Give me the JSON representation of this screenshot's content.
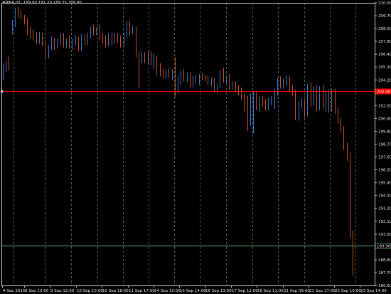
{
  "header": {
    "symbol_tf": "#JPKA,H1",
    "ohlc": "189.90 191.20 189.35 189.90"
  },
  "colors": {
    "background": "#000000",
    "up": "#3a78c8",
    "down": "#c8502a",
    "grid": "#4a6a4a",
    "axis": "#cccccc",
    "bid_line": "#ff0000",
    "price_line": "#5fa87a",
    "text": "#e8e8e8"
  },
  "chart_data": {
    "type": "candlestick",
    "symbol": "#JPKA",
    "timeframe": "H1",
    "ylim": [
      186.6,
      210.0
    ],
    "y_ticks": [
      "210.00",
      "209.70",
      "208.00",
      "207.80",
      "206.40",
      "205.30",
      "204.20",
      "203.10",
      "202.00",
      "200.90",
      "199.80",
      "198.70",
      "197.60",
      "196.50",
      "195.40",
      "194.30",
      "193.20",
      "192.10",
      "191.00",
      "189.90",
      "188.80",
      "187.70",
      "186.60"
    ],
    "x_ticks": [
      "4 Sep 2015",
      "8 Sep 13:00",
      "9 Sep 12:00",
      "10 Sep 10:00",
      "10 Sep 18:00",
      "11 Sep 17:00",
      "14 Sep 15:00",
      "15 Sep 14:00",
      "16 Sep 13:00",
      "17 Sep 12:00",
      "18 Sep 11:00",
      "21 Sep 09:00",
      "21 Sep 17:00",
      "22 Sep 16:00",
      "23 Sep 14:00"
    ],
    "bid_label": "202.68",
    "bid_price": 202.68,
    "last_price_label": "189.90",
    "last_price": 189.9,
    "candles": [
      {
        "o": 204.3,
        "h": 205.0,
        "l": 203.6,
        "c": 204.6
      },
      {
        "o": 204.6,
        "h": 205.2,
        "l": 204.3,
        "c": 205.0
      },
      {
        "o": 205.0,
        "h": 205.6,
        "l": 204.4,
        "c": 204.7
      },
      {
        "o": 207.8,
        "h": 208.6,
        "l": 207.4,
        "c": 208.3
      },
      {
        "o": 208.3,
        "h": 209.6,
        "l": 208.0,
        "c": 209.3
      },
      {
        "o": 209.3,
        "h": 209.7,
        "l": 208.8,
        "c": 209.1
      },
      {
        "o": 209.1,
        "h": 209.4,
        "l": 208.6,
        "c": 208.8
      },
      {
        "o": 208.8,
        "h": 209.0,
        "l": 208.2,
        "c": 208.4
      },
      {
        "o": 208.4,
        "h": 208.7,
        "l": 207.3,
        "c": 207.6
      },
      {
        "o": 207.6,
        "h": 208.0,
        "l": 207.0,
        "c": 207.4
      },
      {
        "o": 207.4,
        "h": 207.8,
        "l": 206.9,
        "c": 207.2
      },
      {
        "o": 207.2,
        "h": 207.6,
        "l": 206.6,
        "c": 206.9
      },
      {
        "o": 206.9,
        "h": 207.6,
        "l": 206.6,
        "c": 207.3
      },
      {
        "o": 207.3,
        "h": 207.5,
        "l": 206.4,
        "c": 206.6
      },
      {
        "o": 206.6,
        "h": 206.9,
        "l": 205.4,
        "c": 205.7
      },
      {
        "o": 205.7,
        "h": 206.5,
        "l": 205.4,
        "c": 206.3
      },
      {
        "o": 206.3,
        "h": 207.2,
        "l": 206.1,
        "c": 206.9
      },
      {
        "o": 206.9,
        "h": 207.1,
        "l": 206.1,
        "c": 206.4
      },
      {
        "o": 206.4,
        "h": 207.0,
        "l": 206.2,
        "c": 206.8
      },
      {
        "o": 206.8,
        "h": 207.5,
        "l": 206.5,
        "c": 207.3
      },
      {
        "o": 207.3,
        "h": 207.5,
        "l": 206.3,
        "c": 206.5
      },
      {
        "o": 206.5,
        "h": 207.0,
        "l": 206.3,
        "c": 206.8
      },
      {
        "o": 206.8,
        "h": 207.3,
        "l": 206.2,
        "c": 206.4
      },
      {
        "o": 206.4,
        "h": 207.0,
        "l": 206.1,
        "c": 206.8
      },
      {
        "o": 206.8,
        "h": 207.3,
        "l": 206.5,
        "c": 207.1
      },
      {
        "o": 207.1,
        "h": 207.2,
        "l": 206.0,
        "c": 206.2
      },
      {
        "o": 206.2,
        "h": 207.4,
        "l": 206.0,
        "c": 207.2
      },
      {
        "o": 207.2,
        "h": 207.4,
        "l": 206.5,
        "c": 206.8
      },
      {
        "o": 206.8,
        "h": 207.5,
        "l": 206.5,
        "c": 207.4
      },
      {
        "o": 207.4,
        "h": 208.0,
        "l": 207.1,
        "c": 207.8
      },
      {
        "o": 207.8,
        "h": 208.2,
        "l": 207.3,
        "c": 207.5
      },
      {
        "o": 207.5,
        "h": 208.0,
        "l": 207.3,
        "c": 207.8
      },
      {
        "o": 207.8,
        "h": 208.2,
        "l": 206.9,
        "c": 207.2
      },
      {
        "o": 207.2,
        "h": 207.5,
        "l": 206.6,
        "c": 207.0
      },
      {
        "o": 207.0,
        "h": 207.3,
        "l": 206.3,
        "c": 206.6
      },
      {
        "o": 206.6,
        "h": 207.5,
        "l": 206.4,
        "c": 207.3
      },
      {
        "o": 207.3,
        "h": 207.5,
        "l": 206.5,
        "c": 206.8
      },
      {
        "o": 206.8,
        "h": 207.5,
        "l": 206.6,
        "c": 207.3
      },
      {
        "o": 207.3,
        "h": 207.5,
        "l": 206.7,
        "c": 206.9
      },
      {
        "o": 206.9,
        "h": 207.3,
        "l": 206.3,
        "c": 206.6
      },
      {
        "o": 206.6,
        "h": 207.5,
        "l": 206.4,
        "c": 207.3
      },
      {
        "o": 207.3,
        "h": 208.5,
        "l": 207.1,
        "c": 208.3
      },
      {
        "o": 208.3,
        "h": 208.5,
        "l": 207.3,
        "c": 207.6
      },
      {
        "o": 207.6,
        "h": 208.1,
        "l": 207.4,
        "c": 207.9
      },
      {
        "o": 207.9,
        "h": 208.0,
        "l": 205.5,
        "c": 205.8
      },
      {
        "o": 205.8,
        "h": 206.0,
        "l": 202.9,
        "c": 205.2
      },
      {
        "o": 205.2,
        "h": 206.0,
        "l": 205.0,
        "c": 205.7
      },
      {
        "o": 205.7,
        "h": 205.9,
        "l": 205.0,
        "c": 205.2
      },
      {
        "o": 205.2,
        "h": 206.0,
        "l": 204.9,
        "c": 205.6
      },
      {
        "o": 205.6,
        "h": 206.0,
        "l": 204.8,
        "c": 205.0
      },
      {
        "o": 205.0,
        "h": 205.8,
        "l": 204.5,
        "c": 205.4
      },
      {
        "o": 205.4,
        "h": 205.6,
        "l": 204.0,
        "c": 204.5
      },
      {
        "o": 204.5,
        "h": 205.0,
        "l": 203.9,
        "c": 204.3
      },
      {
        "o": 204.3,
        "h": 204.6,
        "l": 203.7,
        "c": 203.9
      },
      {
        "o": 203.9,
        "h": 204.5,
        "l": 203.7,
        "c": 204.3
      },
      {
        "o": 204.3,
        "h": 204.6,
        "l": 203.8,
        "c": 204.0
      },
      {
        "o": 204.0,
        "h": 204.5,
        "l": 203.6,
        "c": 204.3
      },
      {
        "o": 204.3,
        "h": 205.5,
        "l": 202.2,
        "c": 203.0
      },
      {
        "o": 203.0,
        "h": 204.0,
        "l": 202.5,
        "c": 203.5
      },
      {
        "o": 203.5,
        "h": 204.4,
        "l": 203.2,
        "c": 204.2
      },
      {
        "o": 204.2,
        "h": 204.5,
        "l": 203.5,
        "c": 203.7
      },
      {
        "o": 203.7,
        "h": 204.2,
        "l": 203.4,
        "c": 204.0
      },
      {
        "o": 204.0,
        "h": 204.3,
        "l": 203.0,
        "c": 203.2
      },
      {
        "o": 203.2,
        "h": 204.0,
        "l": 203.0,
        "c": 203.8
      },
      {
        "o": 203.8,
        "h": 204.0,
        "l": 203.3,
        "c": 203.5
      },
      {
        "o": 203.5,
        "h": 204.1,
        "l": 203.2,
        "c": 203.9
      },
      {
        "o": 203.9,
        "h": 204.2,
        "l": 203.6,
        "c": 203.8
      },
      {
        "o": 203.8,
        "h": 204.0,
        "l": 203.5,
        "c": 203.7
      },
      {
        "o": 203.7,
        "h": 204.0,
        "l": 203.2,
        "c": 203.5
      },
      {
        "o": 203.5,
        "h": 203.8,
        "l": 203.1,
        "c": 203.6
      },
      {
        "o": 203.6,
        "h": 203.8,
        "l": 202.6,
        "c": 202.9
      },
      {
        "o": 202.9,
        "h": 203.3,
        "l": 202.5,
        "c": 203.1
      },
      {
        "o": 203.1,
        "h": 204.4,
        "l": 202.9,
        "c": 204.1
      },
      {
        "o": 204.1,
        "h": 204.6,
        "l": 203.4,
        "c": 203.6
      },
      {
        "o": 203.6,
        "h": 204.0,
        "l": 203.3,
        "c": 203.9
      },
      {
        "o": 203.9,
        "h": 204.1,
        "l": 202.8,
        "c": 203.1
      },
      {
        "o": 203.1,
        "h": 203.5,
        "l": 202.8,
        "c": 203.3
      },
      {
        "o": 203.3,
        "h": 203.5,
        "l": 202.7,
        "c": 203.0
      },
      {
        "o": 203.0,
        "h": 203.2,
        "l": 202.4,
        "c": 202.6
      },
      {
        "o": 202.6,
        "h": 203.0,
        "l": 202.0,
        "c": 202.3
      },
      {
        "o": 202.3,
        "h": 202.5,
        "l": 201.0,
        "c": 201.2
      },
      {
        "o": 201.2,
        "h": 202.3,
        "l": 199.4,
        "c": 200.1
      },
      {
        "o": 200.1,
        "h": 202.5,
        "l": 199.8,
        "c": 201.4
      },
      {
        "o": 201.4,
        "h": 202.7,
        "l": 199.2,
        "c": 202.3
      },
      {
        "o": 202.3,
        "h": 202.6,
        "l": 201.1,
        "c": 201.5
      },
      {
        "o": 201.5,
        "h": 202.3,
        "l": 201.0,
        "c": 202.0
      },
      {
        "o": 202.0,
        "h": 202.3,
        "l": 201.4,
        "c": 201.8
      },
      {
        "o": 201.8,
        "h": 202.0,
        "l": 201.1,
        "c": 201.3
      },
      {
        "o": 201.3,
        "h": 202.1,
        "l": 201.1,
        "c": 201.7
      },
      {
        "o": 201.7,
        "h": 202.3,
        "l": 201.5,
        "c": 201.9
      },
      {
        "o": 201.9,
        "h": 202.9,
        "l": 201.2,
        "c": 202.6
      },
      {
        "o": 202.6,
        "h": 203.8,
        "l": 202.3,
        "c": 203.5
      },
      {
        "o": 203.5,
        "h": 203.9,
        "l": 202.9,
        "c": 203.2
      },
      {
        "o": 203.2,
        "h": 203.7,
        "l": 202.9,
        "c": 203.4
      },
      {
        "o": 203.4,
        "h": 204.0,
        "l": 203.1,
        "c": 203.6
      },
      {
        "o": 203.6,
        "h": 203.9,
        "l": 202.6,
        "c": 202.8
      },
      {
        "o": 202.8,
        "h": 203.2,
        "l": 202.3,
        "c": 202.6
      },
      {
        "o": 202.6,
        "h": 202.8,
        "l": 200.3,
        "c": 200.6
      },
      {
        "o": 200.6,
        "h": 201.9,
        "l": 200.2,
        "c": 201.6
      },
      {
        "o": 201.6,
        "h": 202.1,
        "l": 201.3,
        "c": 201.8
      },
      {
        "o": 201.8,
        "h": 202.0,
        "l": 200.5,
        "c": 200.8
      },
      {
        "o": 200.8,
        "h": 203.3,
        "l": 200.6,
        "c": 203.1
      },
      {
        "o": 203.1,
        "h": 203.4,
        "l": 201.4,
        "c": 201.7
      },
      {
        "o": 201.7,
        "h": 203.1,
        "l": 201.5,
        "c": 202.8
      },
      {
        "o": 202.8,
        "h": 203.2,
        "l": 201.0,
        "c": 201.4
      },
      {
        "o": 201.4,
        "h": 203.1,
        "l": 201.1,
        "c": 202.9
      },
      {
        "o": 202.9,
        "h": 203.2,
        "l": 201.2,
        "c": 201.5
      },
      {
        "o": 201.5,
        "h": 202.8,
        "l": 201.0,
        "c": 202.5
      },
      {
        "o": 202.5,
        "h": 202.8,
        "l": 200.9,
        "c": 201.3
      },
      {
        "o": 201.3,
        "h": 202.9,
        "l": 201.0,
        "c": 202.7
      },
      {
        "o": 202.7,
        "h": 202.9,
        "l": 200.8,
        "c": 201.0
      },
      {
        "o": 201.0,
        "h": 201.3,
        "l": 200.0,
        "c": 200.3
      },
      {
        "o": 200.3,
        "h": 200.5,
        "l": 199.3,
        "c": 199.6
      },
      {
        "o": 199.6,
        "h": 199.8,
        "l": 197.8,
        "c": 198.2
      },
      {
        "o": 198.2,
        "h": 198.4,
        "l": 196.9,
        "c": 197.3
      },
      {
        "o": 197.3,
        "h": 197.6,
        "l": 190.5,
        "c": 190.9
      },
      {
        "o": 190.9,
        "h": 191.2,
        "l": 187.4,
        "c": 189.9
      }
    ]
  }
}
